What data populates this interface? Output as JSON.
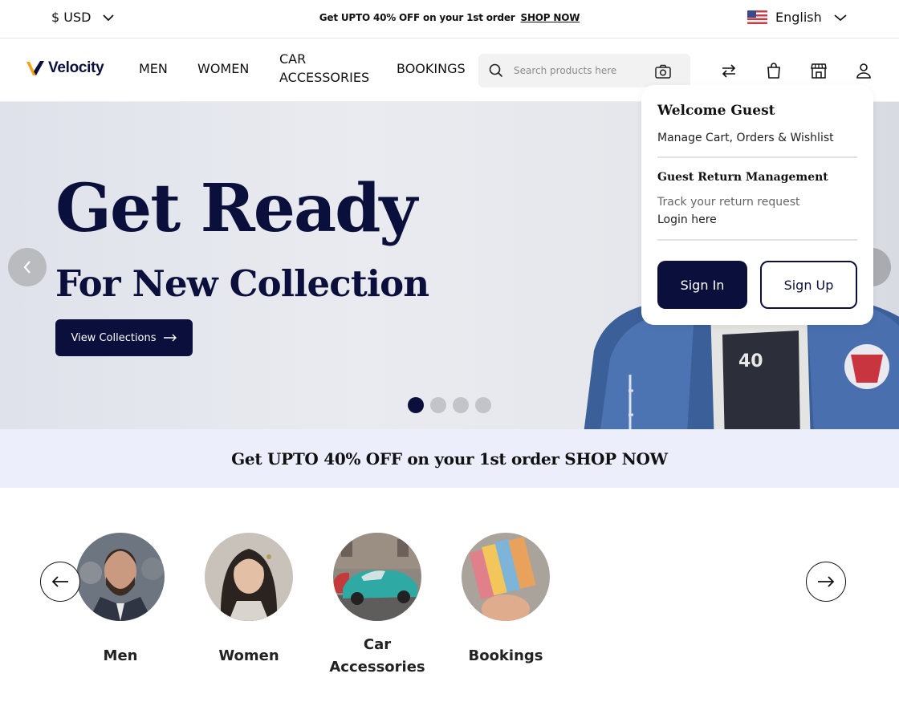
{
  "topbar": {
    "currency": "$ USD",
    "promo_text": "Get UPTO 40% OFF on your 1st order",
    "promo_link": "SHOP NOW",
    "language": "English"
  },
  "header": {
    "logo_text": "Velocity",
    "nav": [
      "MEN",
      "WOMEN",
      "CAR",
      "ACCESSORIES",
      "BOOKINGS"
    ],
    "search_placeholder": "Search products here",
    "icons": [
      "compare-icon",
      "bag-icon",
      "store-icon",
      "user-icon"
    ]
  },
  "hero": {
    "headline": "Get Ready",
    "subheadline": "For New Collection",
    "cta_label": "View Collections",
    "slides_total": 4,
    "active_slide": 1
  },
  "promo_band": {
    "text": "Get UPTO 40% OFF on your 1st order SHOP NOW"
  },
  "categories": [
    {
      "label": "Men"
    },
    {
      "label": "Women"
    },
    {
      "label_line1": "Car",
      "label_line2": "Accessories"
    },
    {
      "label": "Bookings"
    }
  ],
  "account_dropdown": {
    "title": "Welcome Guest",
    "subtitle": "Manage Cart, Orders & Wishlist",
    "section_title": "Guest Return Management",
    "track_text": "Track your return request",
    "login_text": "Login here",
    "signin_label": "Sign In",
    "signup_label": "Sign Up"
  },
  "colors": {
    "brand_navy": "#0b0f3b",
    "promo_band_bg": "#eceefc",
    "logo_accent": "#f2a516"
  }
}
